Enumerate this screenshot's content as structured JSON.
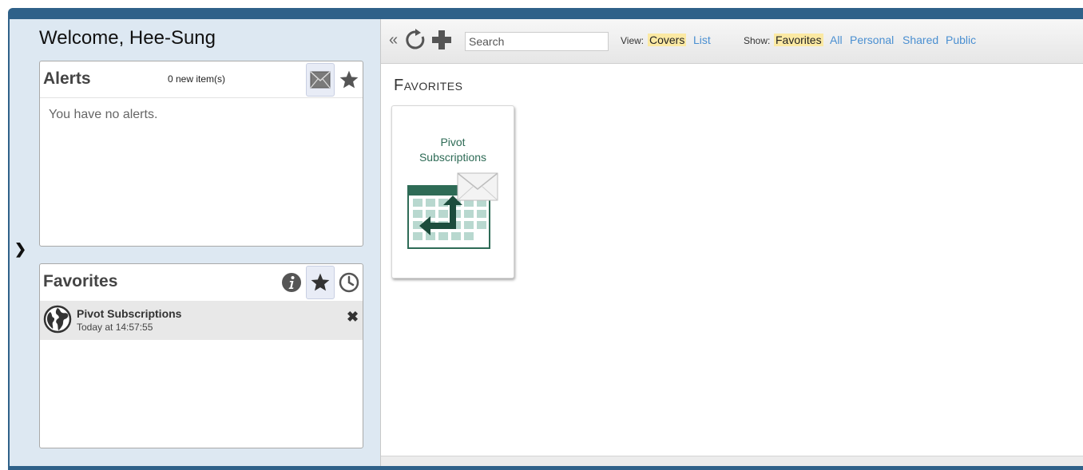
{
  "welcome": "Welcome, Hee-Sung",
  "alerts": {
    "title": "Alerts",
    "count": "0 new item(s)",
    "empty_message": "You have no alerts."
  },
  "favorites_panel": {
    "title": "Favorites",
    "items": [
      {
        "name": "Pivot Subscriptions",
        "time": "Today at 14:57:55",
        "icon": "globe-icon"
      }
    ]
  },
  "toolbar": {
    "collapse": "«",
    "search_placeholder": "Search",
    "view_label": "View:",
    "view_options": [
      "Covers",
      "List"
    ],
    "view_selected": "Covers",
    "show_label": "Show:",
    "show_options": [
      "Favorites",
      "All",
      "Personal",
      "Shared",
      "Public"
    ],
    "show_selected": "Favorites"
  },
  "main": {
    "section_title": "Favorites",
    "tiles": [
      {
        "title_line1": "Pivot",
        "title_line2": "Subscriptions",
        "icon": "pivot-subscriptions-icon"
      }
    ]
  },
  "colors": {
    "frame": "#2f6189",
    "sidebar_bg": "#dde8f2",
    "highlight": "#fbe9a3",
    "link": "#4a8fd1",
    "tile_green": "#2e6b56"
  }
}
